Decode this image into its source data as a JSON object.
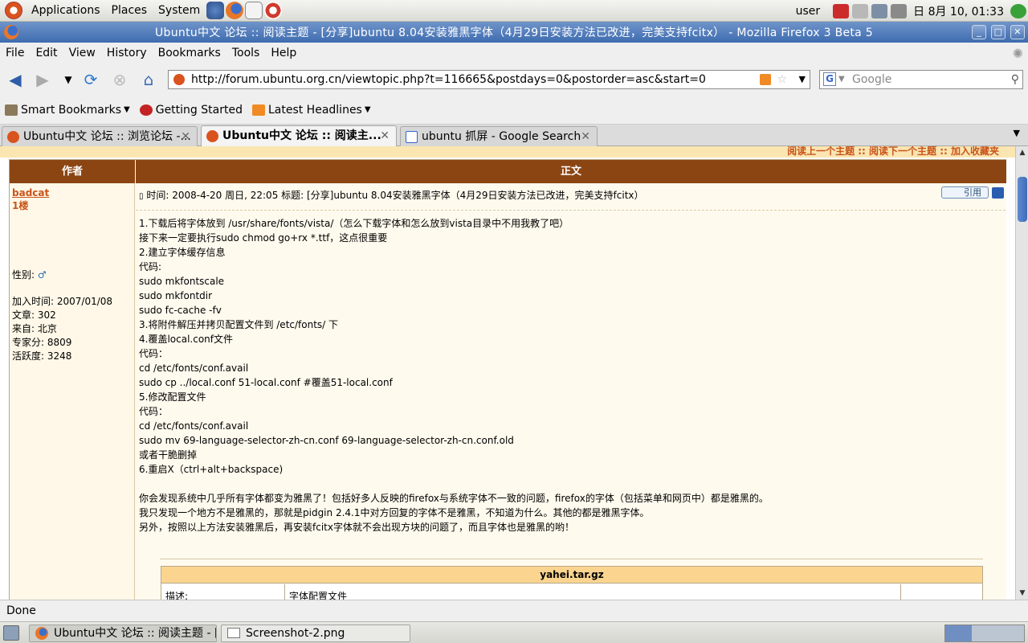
{
  "top_panel": {
    "menus": [
      "Applications",
      "Places",
      "System"
    ],
    "user": "user",
    "clock": "日  8月 10, 01:33"
  },
  "window": {
    "title": "Ubuntu中文 论坛 :: 阅读主题 - [分享]ubuntu 8.04安装雅黑字体（4月29日安装方法已改进，完美支持fcitx） - Mozilla Firefox 3 Beta 5"
  },
  "menubar": [
    "File",
    "Edit",
    "View",
    "History",
    "Bookmarks",
    "Tools",
    "Help"
  ],
  "navbar": {
    "url": "http://forum.ubuntu.org.cn/viewtopic.php?t=116665&postdays=0&postorder=asc&start=0",
    "search_placeholder": "Google"
  },
  "bookmarks": [
    "Smart Bookmarks",
    "Getting Started",
    "Latest Headlines"
  ],
  "tabs": [
    {
      "label": "Ubuntu中文 论坛 :: 浏览论坛 -..."
    },
    {
      "label": "Ubuntu中文 论坛 :: 阅读主..."
    },
    {
      "label": "ubuntu 抓屏 - Google Search"
    }
  ],
  "forum": {
    "nav_links": "阅读上一个主题 :: 阅读下一个主题 :: 加入收藏夹",
    "col_author": "作者",
    "col_body": "正文",
    "author": {
      "name": "badcat",
      "floor": "1楼",
      "gender_label": "性别:",
      "joined": "加入时间: 2007/01/08",
      "posts": "文章: 302",
      "from": "来自: 北京",
      "expert": "专家分: 8809",
      "activity": "活跃度: 3248"
    },
    "post_meta": "时间: 2008-4-20 周日, 22:05    标题: [分享]ubuntu 8.04安装雅黑字体（4月29日安装方法已改进，完美支持fcitx）",
    "quote_label": "引用",
    "body_lines": [
      "1.下载后将字体放到 /usr/share/fonts/vista/（怎么下载字体和怎么放到vista目录中不用我教了吧）",
      "接下来一定要执行sudo chmod go+rx *.ttf，这点很重要",
      "2.建立字体缓存信息",
      "代码:",
      "sudo mkfontscale",
      "sudo mkfontdir",
      "sudo fc-cache -fv",
      "3.将附件解压并拷贝配置文件到 /etc/fonts/ 下",
      "4.覆盖local.conf文件",
      "代码：",
      "cd /etc/fonts/conf.avail",
      "sudo cp ../local.conf 51-local.conf #覆盖51-local.conf",
      "5.修改配置文件",
      "代码：",
      "cd /etc/fonts/conf.avail",
      "sudo mv 69-language-selector-zh-cn.conf 69-language-selector-zh-cn.conf.old",
      "或者干脆删掉",
      "6.重启X（ctrl+alt+backspace)",
      "",
      "你会发现系统中几乎所有字体都变为雅黑了！包括好多人反映的firefox与系统字体不一致的问题，firefox的字体（包括菜单和网页中）都是雅黑的。",
      "我只发现一个地方不是雅黑的，那就是pidgin 2.4.1中对方回复的字体不是雅黑，不知道为什么。其他的都是雅黑字体。",
      "另外，按照以上方法安装雅黑后，再安装fcitx字体就不会出现方块的问题了，而且字体也是雅黑的哟！"
    ],
    "attachment": {
      "filename": "yahei.tar.gz",
      "desc_label": "描述:",
      "desc_value": "字体配置文件"
    }
  },
  "statusbar": "Done",
  "taskbar": [
    {
      "label": "Ubuntu中文 论坛 :: 阅读主题 - [..."
    },
    {
      "label": "Screenshot-2.png"
    }
  ],
  "colors": {
    "forum_header": "#8b4513",
    "accent_orange": "#c8541a",
    "titlebar_blue": "#3e6cb0"
  }
}
